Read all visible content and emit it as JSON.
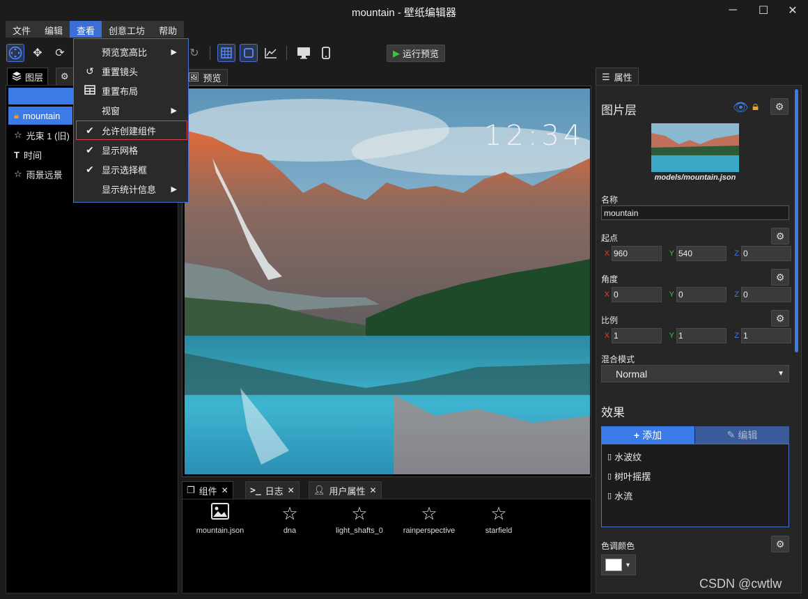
{
  "window": {
    "title": "mountain - 壁纸编辑器"
  },
  "menubar": [
    "文件",
    "编辑",
    "查看",
    "创意工坊",
    "帮助"
  ],
  "menubar_active": "查看",
  "view_menu": [
    {
      "label": "预览宽高比",
      "icon": "",
      "submenu": true
    },
    {
      "label": "重置镜头",
      "icon": "undo-icon",
      "submenu": false
    },
    {
      "label": "重置布局",
      "icon": "table-icon",
      "submenu": false
    },
    {
      "label": "视窗",
      "icon": "",
      "submenu": true
    },
    {
      "label": "允许创建组件",
      "icon": "check-icon",
      "submenu": false,
      "highlighted": true
    },
    {
      "label": "显示网格",
      "icon": "check-icon",
      "submenu": false
    },
    {
      "label": "显示选择框",
      "icon": "check-icon",
      "submenu": false
    },
    {
      "label": "显示统计信息",
      "icon": "",
      "submenu": true
    }
  ],
  "toolbar": {
    "run_label": "运行预览"
  },
  "left_panel": {
    "tabs": [
      "图层",
      ""
    ],
    "add_label": "+",
    "layers": [
      {
        "label": "mountain",
        "icon": "lock-icon",
        "selected": true
      },
      {
        "label": "光束 1 (旧)",
        "icon": "star-icon"
      },
      {
        "label": "时间",
        "icon": "text-icon"
      },
      {
        "label": "雨景远景",
        "icon": "star-icon"
      }
    ]
  },
  "preview": {
    "tab": "预览",
    "clock": "12:34"
  },
  "bottom": {
    "tabs": [
      "组件",
      "日志",
      "用户属性"
    ],
    "components": [
      {
        "label": "mountain.json",
        "icon": "image-icon"
      },
      {
        "label": "dna",
        "icon": "star-icon"
      },
      {
        "label": "light_shafts_0",
        "icon": "star-icon"
      },
      {
        "label": "rainperspective",
        "icon": "star-icon"
      },
      {
        "label": "starfield",
        "icon": "star-icon"
      }
    ]
  },
  "properties": {
    "tab": "属性",
    "heading": "图片层",
    "model_path": "models/mountain.json",
    "name_label": "名称",
    "name_value": "mountain",
    "origin_label": "起点",
    "origin": {
      "x": "960",
      "y": "540",
      "z": "0"
    },
    "angle_label": "角度",
    "angle": {
      "x": "0",
      "y": "0",
      "z": "0"
    },
    "scale_label": "比例",
    "scale": {
      "x": "1",
      "y": "1",
      "z": "1"
    },
    "axis_x": "X",
    "axis_y": "Y",
    "axis_z": "Z",
    "blend_label": "混合模式",
    "blend_value": "Normal",
    "effects_heading": "效果",
    "add_label": "添加",
    "edit_label": "编辑",
    "effects": [
      "水波纹",
      "树叶摇摆",
      "水流"
    ],
    "tint_label": "色调颜色",
    "tint_color": "#ffffff"
  },
  "colors": {
    "accent": "#3b7be8",
    "highlight_border": "#e04040",
    "lock": "#f0a020"
  },
  "watermark": "CSDN @cwtlw"
}
